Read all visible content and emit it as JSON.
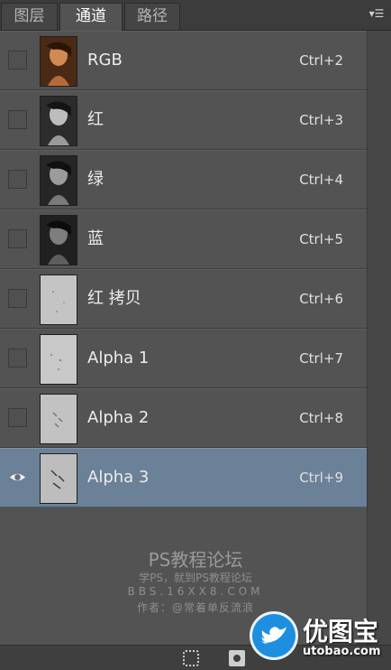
{
  "tabs": [
    {
      "label": "图层",
      "active": false
    },
    {
      "label": "通道",
      "active": true
    },
    {
      "label": "路径",
      "active": false
    }
  ],
  "panel_menu_icon": "panel-menu-icon",
  "channels": [
    {
      "name": "RGB",
      "shortcut": "Ctrl+2",
      "visible": false,
      "selected": false,
      "thumb": "color"
    },
    {
      "name": "红",
      "shortcut": "Ctrl+3",
      "visible": false,
      "selected": false,
      "thumb": "gray-dark"
    },
    {
      "name": "绿",
      "shortcut": "Ctrl+4",
      "visible": false,
      "selected": false,
      "thumb": "gray-dark"
    },
    {
      "name": "蓝",
      "shortcut": "Ctrl+5",
      "visible": false,
      "selected": false,
      "thumb": "gray-dark"
    },
    {
      "name": "红 拷贝",
      "shortcut": "Ctrl+6",
      "visible": false,
      "selected": false,
      "thumb": "gray-light"
    },
    {
      "name": "Alpha 1",
      "shortcut": "Ctrl+7",
      "visible": false,
      "selected": false,
      "thumb": "gray-light"
    },
    {
      "name": "Alpha 2",
      "shortcut": "Ctrl+8",
      "visible": false,
      "selected": false,
      "thumb": "gray-light"
    },
    {
      "name": "Alpha 3",
      "shortcut": "Ctrl+9",
      "visible": true,
      "selected": true,
      "thumb": "gray-light"
    }
  ],
  "watermark": {
    "line1": "PS教程论坛",
    "line2": "学PS，就到PS教程论坛",
    "line3": "BBS.16XX8.COM",
    "line4": "作者：@常着单反流浪"
  },
  "logo": {
    "title": "优图宝",
    "url": "utobao.com",
    "brand_color": "#1e8fe0"
  },
  "colors": {
    "panel_bg": "#535353",
    "selected_row": "#6b8197",
    "tabbar_bg": "#3c3c3c"
  }
}
